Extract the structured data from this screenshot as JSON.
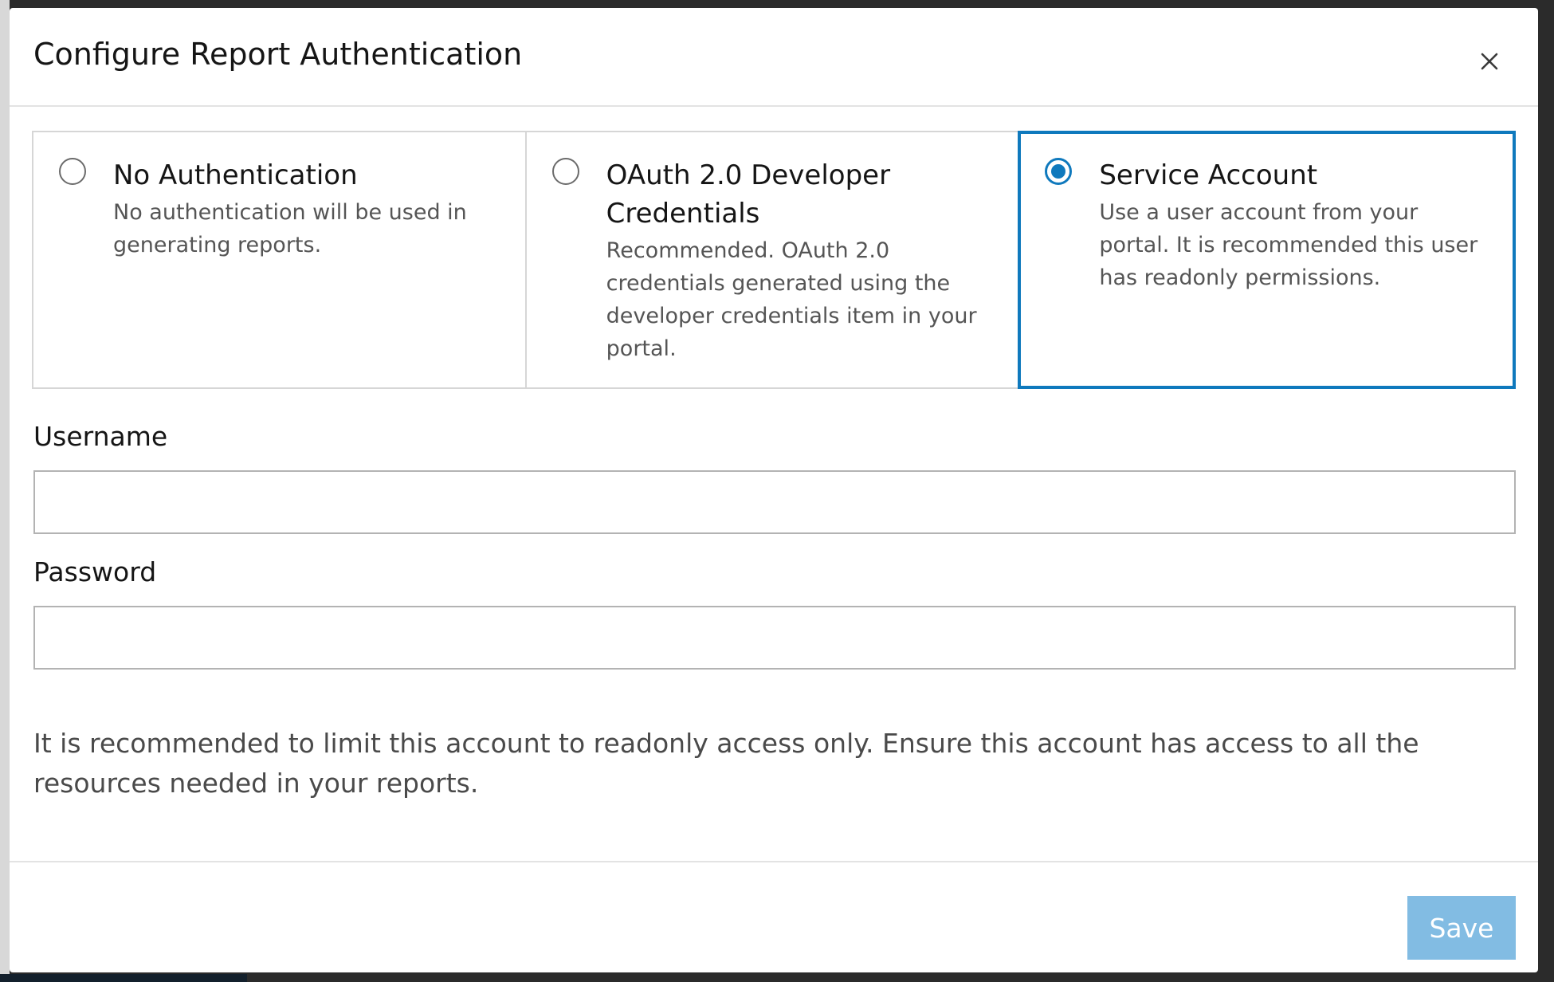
{
  "modal": {
    "title": "Configure Report Authentication",
    "close_icon": "close-icon"
  },
  "auth_options": [
    {
      "title": "No Authentication",
      "description": "No authentication will be used in generating reports.",
      "selected": false
    },
    {
      "title": "OAuth 2.0 Developer Credentials",
      "description": "Recommended. OAuth 2.0 credentials generated using the developer credentials item in your portal.",
      "selected": false
    },
    {
      "title": "Service Account",
      "description": "Use a user account from your portal. It is recommended this user has readonly permissions.",
      "selected": true
    }
  ],
  "form": {
    "username_label": "Username",
    "username_value": "",
    "password_label": "Password",
    "password_value": ""
  },
  "note": "It is recommended to limit this account to readonly access only. Ensure this account has access to all the resources needed in your reports.",
  "footer": {
    "save_label": "Save",
    "save_enabled": false
  },
  "colors": {
    "accent": "#0f79bd",
    "save_disabled_bg": "#82bce3"
  }
}
